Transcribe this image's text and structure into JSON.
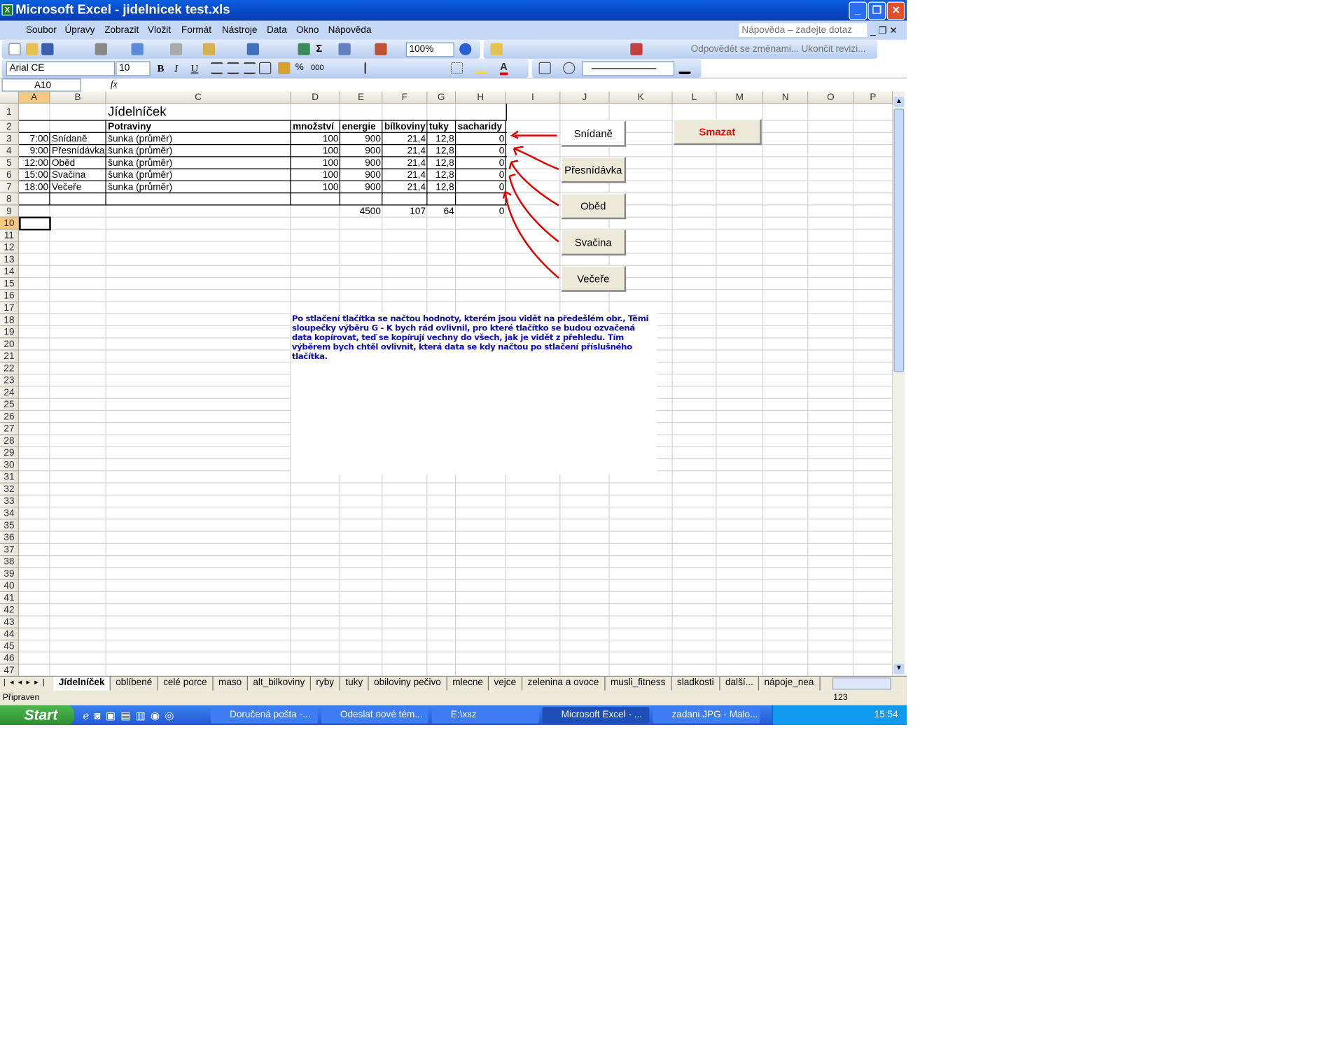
{
  "window": {
    "title": "Microsoft Excel - jidelnicek test.xls"
  },
  "menu": [
    "Soubor",
    "Úpravy",
    "Zobrazit",
    "Vložit",
    "Formát",
    "Nástroje",
    "Data",
    "Okno",
    "Nápověda"
  ],
  "help_placeholder": "Nápověda – zadejte dotaz",
  "toolbar": {
    "zoom": "100%",
    "review": "Odpovědět se změnami...",
    "end_review": "Ukončit revizi...",
    "font": "Arial CE",
    "size": "10",
    "bold": "B",
    "italic": "I",
    "underline": "U",
    "percent": "%",
    "thousands": "000",
    "sum": "Σ"
  },
  "namebox": "A10",
  "fx": "fx",
  "columns": [
    "A",
    "B",
    "C",
    "D",
    "E",
    "F",
    "G",
    "H",
    "I",
    "J",
    "K",
    "L",
    "M",
    "N",
    "O",
    "P"
  ],
  "sheet": {
    "title": "Jídelníček",
    "headers": {
      "potraviny": "Potraviny",
      "mnozstvi": "množství",
      "energie": "energie",
      "bilkoviny": "bílkoviny",
      "tuky": "tuky",
      "sacharidy": "sacharidy"
    },
    "rows": [
      {
        "time": "7:00",
        "meal": "Snídaně",
        "food": "šunka (průměr)",
        "qty": "100",
        "energy": "900",
        "protein": "21,4",
        "fat": "12,8",
        "carbs": "0"
      },
      {
        "time": "9:00",
        "meal": "Přesnídávka",
        "food": "šunka (průměr)",
        "qty": "100",
        "energy": "900",
        "protein": "21,4",
        "fat": "12,8",
        "carbs": "0"
      },
      {
        "time": "12:00",
        "meal": "Oběd",
        "food": "šunka (průměr)",
        "qty": "100",
        "energy": "900",
        "protein": "21,4",
        "fat": "12,8",
        "carbs": "0"
      },
      {
        "time": "15:00",
        "meal": "Svačina",
        "food": "šunka (průměr)",
        "qty": "100",
        "energy": "900",
        "protein": "21,4",
        "fat": "12,8",
        "carbs": "0"
      },
      {
        "time": "18:00",
        "meal": "Večeře",
        "food": "šunka (průměr)",
        "qty": "100",
        "energy": "900",
        "protein": "21,4",
        "fat": "12,8",
        "carbs": "0"
      }
    ],
    "totals": {
      "energy": "4500",
      "protein": "107",
      "fat": "64",
      "carbs": "0"
    }
  },
  "buttons": {
    "snidane": "Snídaně",
    "presnidavka": "Přesnídávka",
    "obed": "Oběd",
    "svacina": "Svačina",
    "vecere": "Večeře",
    "smazat": "Smazat"
  },
  "note": "Po stlačení tlačítka se načtou hodnoty, kterém jsou vidět na předešlém obr., Těmi sloupečky výběru G - K bych rád ovlivnil, pro které tlačítko se budou ozvačená data kopírovat, teď se kopírují vechny do všech, jak je vidět z přehledu. Tím výběrem bych chtěl ovlivnit, která data se kdy načtou po stlačení příslušného tlačítka.",
  "sheet_tabs": [
    "Jídelníček",
    "oblíbené",
    "celé porce",
    "maso",
    "alt_bilkoviny",
    "ryby",
    "tuky",
    "obiloviny pečivo",
    "mlecne",
    "vejce",
    "zelenina a ovoce",
    "musli_fitness",
    "sladkosti",
    "další...",
    "nápoje_nea"
  ],
  "status": {
    "ready": "Připraven",
    "num": "123"
  },
  "taskbar": {
    "start": "Start",
    "tasks": [
      "Doručená pošta -...",
      "Odeslat nové tém...",
      "E:\\xxz",
      "Microsoft Excel - ...",
      "zadani.JPG - Malo..."
    ],
    "clock": "15:54"
  },
  "colors": {
    "accent": "#0a5fe0",
    "note": "#1010b0",
    "smazat": "#e01010",
    "arrows": "#e00000"
  }
}
